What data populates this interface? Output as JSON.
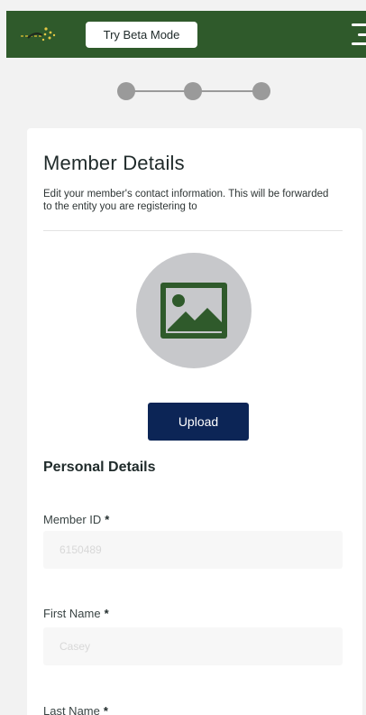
{
  "header": {
    "beta_button_label": "Try Beta Mode",
    "logo_icon": "brand-logo-icon",
    "menu_icon": "hamburger-menu-icon",
    "colors": {
      "bar": "#2f5a2b",
      "button": "#ffffff"
    }
  },
  "stepper": {
    "steps": 3
  },
  "card": {
    "title": "Member Details",
    "subtitle": "Edit your member's contact information. This will be forwarded to the entity you are registering to",
    "avatar_icon": "image-placeholder-icon",
    "upload_label": "Upload",
    "section_title": "Personal Details",
    "fields": [
      {
        "label": "Member ID",
        "required_mark": "*",
        "value": "6150489"
      },
      {
        "label": "First Name",
        "required_mark": "*",
        "value": "Casey"
      },
      {
        "label": "Last Name",
        "required_mark": "*",
        "value": ""
      }
    ],
    "colors": {
      "upload_button": "#0c2556",
      "avatar_bg": "#c7c8cb",
      "icon_green": "#2f5a2b"
    }
  }
}
